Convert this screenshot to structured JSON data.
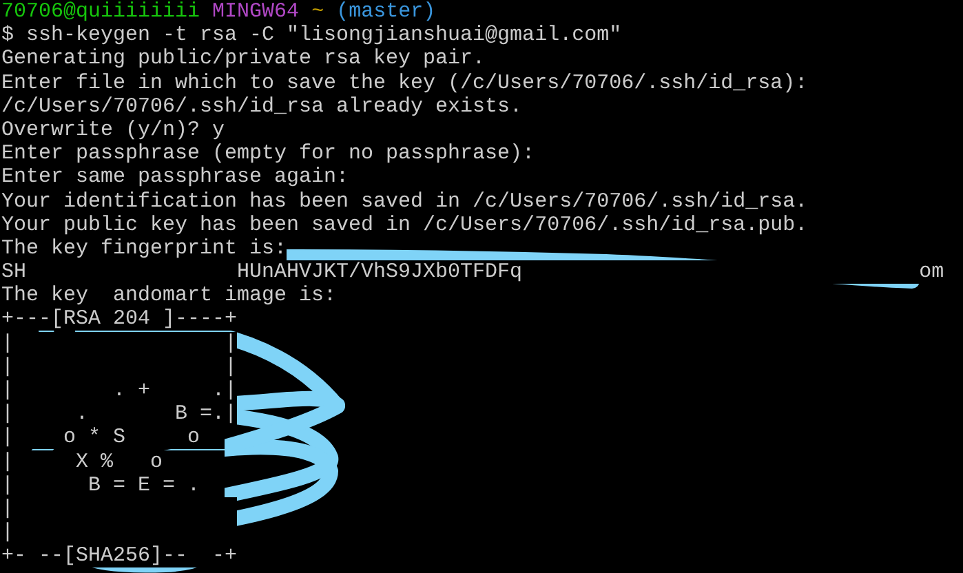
{
  "prompt": {
    "user_host": "70706@quiiiiiiii",
    "system": "MINGW64",
    "path": "~",
    "branch": "(master)"
  },
  "lines": [
    "$ ssh-keygen -t rsa -C \"lisongjianshuai@gmail.com\"",
    "Generating public/private rsa key pair.",
    "Enter file in which to save the key (/c/Users/70706/.ssh/id_rsa):",
    "/c/Users/70706/.ssh/id_rsa already exists.",
    "Overwrite (y/n)? y",
    "Enter passphrase (empty for no passphrase):",
    "Enter same passphrase again:",
    "Your identification has been saved in /c/Users/70706/.ssh/id_rsa.",
    "Your public key has been saved in /c/Users/70706/.ssh/id_rsa.pub.",
    "The key fingerprint is:",
    "SH                 HUnAHVJKT/VhS9JXb0TFDFq                                om",
    "The key  andomart image is:",
    "+---[RSA 204 ]----+",
    "|                 |",
    "|                 |",
    "|        . +     .|",
    "|     .       B =.|",
    "|    o * S     o  ",
    "|     X %   o     ",
    "|      B = E = .  ",
    "|                  ",
    "|                  ",
    "+- --[SHA256]--  -+"
  ]
}
